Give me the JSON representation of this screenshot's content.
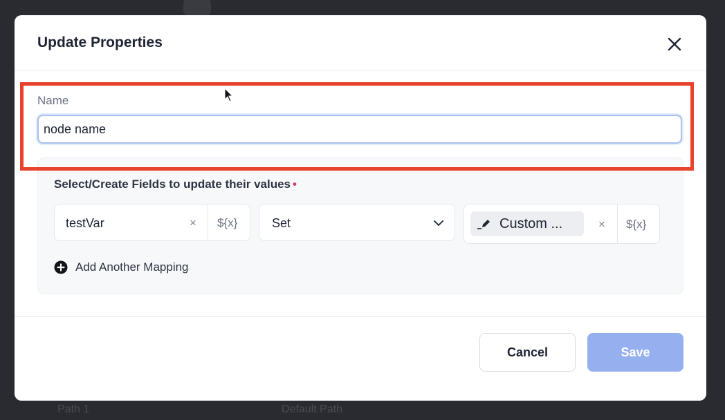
{
  "modal": {
    "title": "Update Properties",
    "close_icon": "close-icon"
  },
  "name_field": {
    "label": "Name",
    "value": "node name"
  },
  "mapping_section": {
    "title": "Select/Create Fields to update their values",
    "required_marker": "•",
    "variable": {
      "value": "testVar",
      "clear_label": "×",
      "variable_token": "${x}"
    },
    "operation": {
      "selected": "Set",
      "icon": "chevron-down-icon"
    },
    "value": {
      "chip_prefix": "_",
      "chip_icon": "pencil-icon",
      "chip_label": "Custom ...",
      "clear_label": "×",
      "variable_token": "${x}"
    },
    "add_mapping_label": "Add Another Mapping",
    "add_mapping_icon": "plus-circle-icon"
  },
  "footer": {
    "cancel_label": "Cancel",
    "save_label": "Save"
  },
  "background": {
    "label_left": "Path 1",
    "label_right": "Default Path"
  },
  "colors": {
    "highlight": "#e7432d",
    "save_disabled": "#96b0ef",
    "required": "#d4376b",
    "input_focus": "#a7c0ec"
  }
}
